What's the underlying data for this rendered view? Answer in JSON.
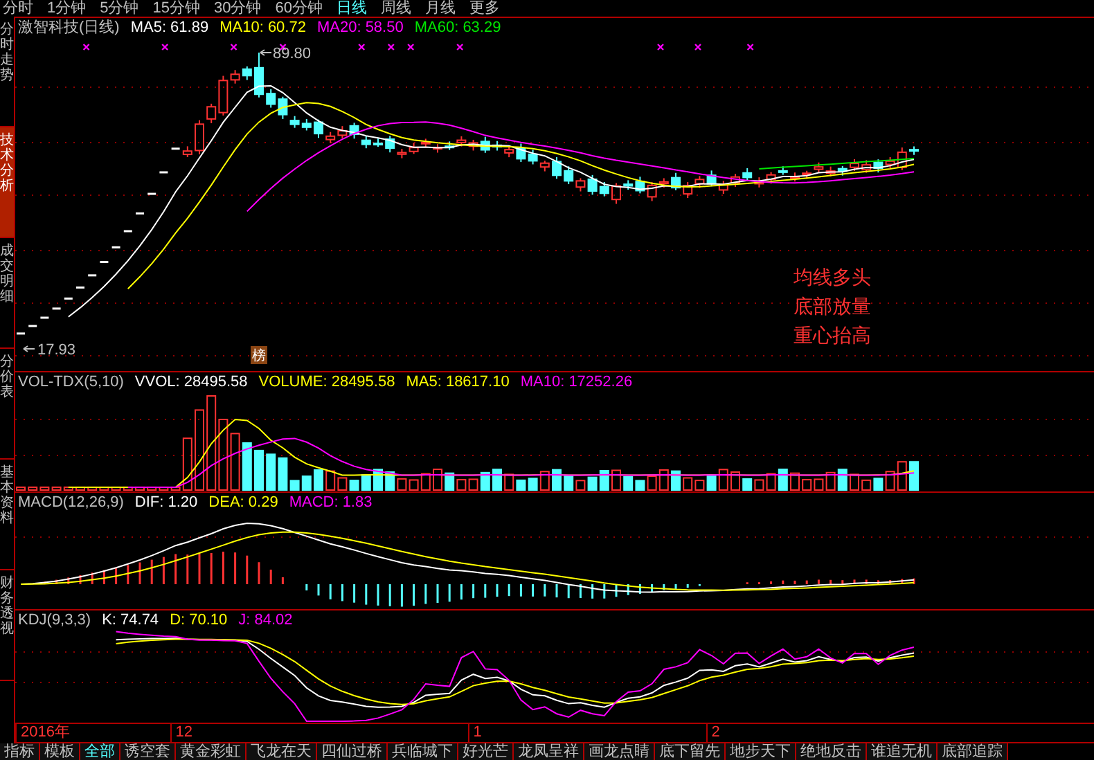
{
  "top_bar": {
    "tabs": [
      {
        "label": "分时",
        "selected": false
      },
      {
        "label": "1分钟",
        "selected": false
      },
      {
        "label": "5分钟",
        "selected": false
      },
      {
        "label": "15分钟",
        "selected": false
      },
      {
        "label": "30分钟",
        "selected": false
      },
      {
        "label": "60分钟",
        "selected": false
      },
      {
        "label": "日线",
        "selected": true
      },
      {
        "label": "周线",
        "selected": false
      },
      {
        "label": "月线",
        "selected": false
      },
      {
        "label": "更多",
        "selected": false
      }
    ]
  },
  "sidebar": {
    "tabs": [
      {
        "label": "分时走势",
        "selected": false
      },
      {
        "label": "技术分析",
        "selected": true
      },
      {
        "label": "成交明细",
        "selected": false
      },
      {
        "label": "分价表",
        "selected": false
      },
      {
        "label": "基本资料",
        "selected": false
      },
      {
        "label": "财务透视",
        "selected": false
      }
    ]
  },
  "main_chart": {
    "title": "激智科技(日线)",
    "legend": [
      {
        "label": "MA5: 61.89",
        "color": "#ffffff"
      },
      {
        "label": "MA10: 60.72",
        "color": "#ffff00"
      },
      {
        "label": "MA20: 58.50",
        "color": "#ff00ff"
      },
      {
        "label": "MA60: 63.29",
        "color": "#00e600"
      }
    ],
    "high_label": "89.80",
    "low_label": "17.93",
    "marker": "榜",
    "annotation": [
      "均线多头",
      "底部放量",
      "重心抬高"
    ]
  },
  "volume_panel": {
    "title": "VOL-TDX(5,10)",
    "legend": [
      {
        "label": "VVOL: 28495.58",
        "color": "#ffffff"
      },
      {
        "label": "VOLUME: 28495.58",
        "color": "#ffff00"
      },
      {
        "label": "MA5: 18617.10",
        "color": "#ffff00"
      },
      {
        "label": "MA10: 17252.26",
        "color": "#ff00ff"
      }
    ]
  },
  "macd_panel": {
    "title": "MACD(12,26,9)",
    "legend": [
      {
        "label": "DIF: 1.20",
        "color": "#ffffff"
      },
      {
        "label": "DEA: 0.29",
        "color": "#ffff00"
      },
      {
        "label": "MACD: 1.83",
        "color": "#ff00ff"
      }
    ]
  },
  "kdj_panel": {
    "title": "KDJ(9,3,3)",
    "legend": [
      {
        "label": "K: 74.74",
        "color": "#ffffff"
      },
      {
        "label": "D: 70.10",
        "color": "#ffff00"
      },
      {
        "label": "J: 84.02",
        "color": "#ff00ff"
      }
    ]
  },
  "date_axis": [
    "2016年",
    "12",
    "1",
    "2"
  ],
  "bottom_tabs": [
    {
      "label": "指标",
      "selected": false
    },
    {
      "label": "模板",
      "selected": false
    },
    {
      "label": "全部",
      "selected": true
    },
    {
      "label": "诱空套",
      "selected": false
    },
    {
      "label": "黄金彩虹",
      "selected": false
    },
    {
      "label": "飞龙在天",
      "selected": false
    },
    {
      "label": "四仙过桥",
      "selected": false
    },
    {
      "label": "兵临城下",
      "selected": false
    },
    {
      "label": "好光芒",
      "selected": false
    },
    {
      "label": "龙凤呈祥",
      "selected": false
    },
    {
      "label": "画龙点睛",
      "selected": false
    },
    {
      "label": "底下留先",
      "selected": false
    },
    {
      "label": "地步天下",
      "selected": false
    },
    {
      "label": "绝地反击",
      "selected": false
    },
    {
      "label": "谁追无机",
      "selected": false
    },
    {
      "label": "底部追踪",
      "selected": false
    }
  ]
}
